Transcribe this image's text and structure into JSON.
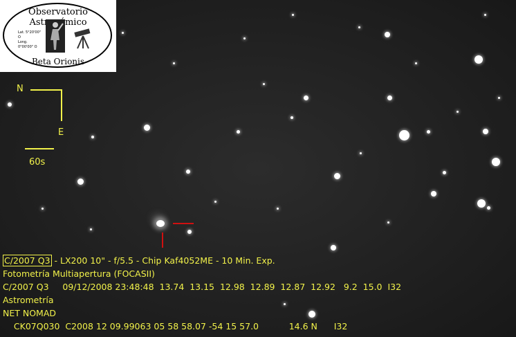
{
  "logo": {
    "title": "Observatorio Astronómico",
    "subtitle": "Beta Orionis",
    "coord_lat": "Lat. 5°20'00\" O",
    "coord_long": "Long. 0°00'00\" O"
  },
  "orientation": {
    "north": "N",
    "east": "E",
    "scale": "60s"
  },
  "caption": {
    "object": "C/2007 Q3",
    "line1_rest": " - LX200 10\" - f/5.5 - Chip Kaf4052ME - 10 Min. Exp.",
    "line2": "Fotometría Multiapertura (FOCASII)",
    "line3": "C/2007 Q3     09/12/2008 23:48:48  13.74  13.15  12.98  12.89  12.87  12.92   9.2  15.0  I32",
    "line4": "Astrometría",
    "line5": "NET NOMAD",
    "line6": "    CK07Q030  C2008 12 09.99063 05 58 58.07 -54 15 57.0           14.6 N      I32"
  },
  "colors": {
    "caption_text": "#f2f24a",
    "marker": "#d01010",
    "background": "#222222"
  }
}
